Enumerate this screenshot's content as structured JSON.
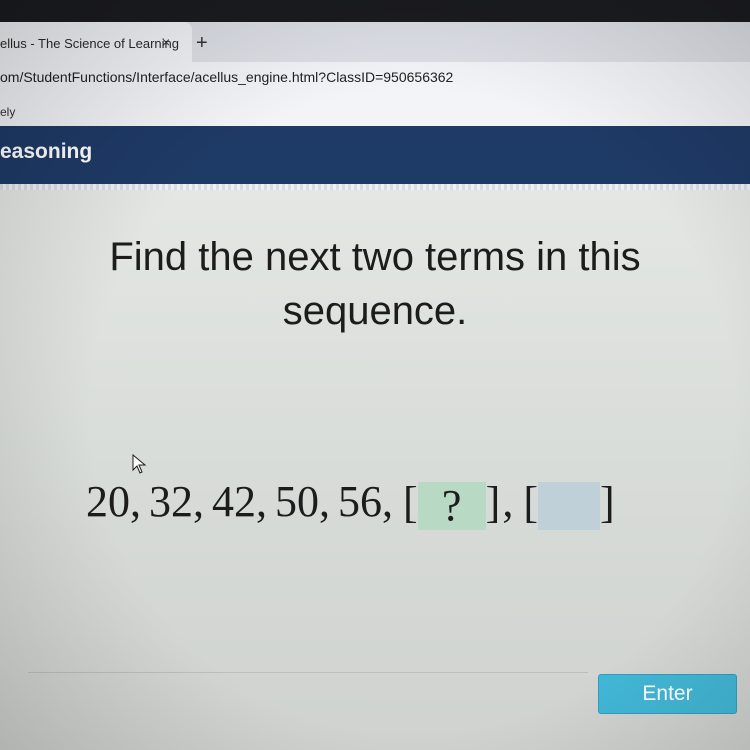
{
  "browser": {
    "tab_title": "ellus - The Science of Learning",
    "tab_close": "×",
    "new_tab": "+",
    "url": "om/StudentFunctions/Interface/acellus_engine.html?ClassID=950656362",
    "bookmark": "ely"
  },
  "app": {
    "title": "easoning"
  },
  "question": {
    "prompt": "Find the next two terms in this sequence.",
    "terms": [
      "20",
      "32",
      "42",
      "50",
      "56"
    ],
    "separator": ",",
    "blank_open": "[",
    "blank_close": "]",
    "blank_1_value": "?",
    "blank_2_value": ""
  },
  "actions": {
    "enter_label": "Enter"
  },
  "colors": {
    "header_bg": "#1e3a66",
    "enter_bg": "#42b7d6",
    "blank_1_bg": "#b8d9c4",
    "blank_2_bg": "#bfd0d9"
  },
  "icons": {
    "cursor": "mouse-pointer-icon",
    "close": "close-icon",
    "new_tab": "plus-icon"
  }
}
